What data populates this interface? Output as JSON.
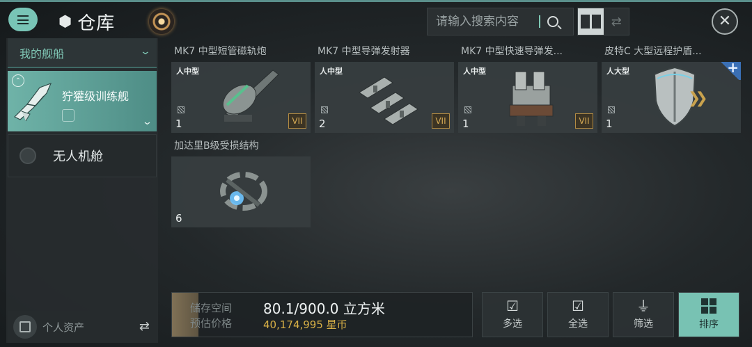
{
  "header": {
    "title": "仓库",
    "search_placeholder": "请输入搜索内容",
    "close_glyph": "✕"
  },
  "sidebar": {
    "dropdown_label": "我的舰船",
    "selected_ship": "狞獾级训练舰",
    "drone_bay": "无人机舱",
    "personal_assets": "个人资产"
  },
  "items": [
    {
      "name": "MK7 中型短管磁轨炮",
      "size": "人中型",
      "qty": "1",
      "tier": "VII",
      "icon": "railgun-icon"
    },
    {
      "name": "MK7 中型导弹发射器",
      "size": "人中型",
      "qty": "2",
      "tier": "VII",
      "icon": "missile-launcher-icon"
    },
    {
      "name": "MK7 中型快速导弹发...",
      "size": "人中型",
      "qty": "1",
      "tier": "VII",
      "icon": "rapid-missile-icon"
    },
    {
      "name": "皮特C 大型远程护盾...",
      "size": "人大型",
      "qty": "1",
      "tier": "",
      "icon": "shield-icon"
    },
    {
      "name": "加达里B级受损结构",
      "size": "",
      "qty": "6",
      "tier": "",
      "icon": "structure-icon"
    }
  ],
  "footer": {
    "storage_label": "储存空间",
    "price_label": "预估价格",
    "storage_value": "80.1/900.0 立方米",
    "price_value": "40,174,995 星币",
    "btn_multi": "多选",
    "btn_all": "全选",
    "btn_filter": "筛选",
    "btn_sort": "排序"
  },
  "colors": {
    "accent": "#78c4b6",
    "gold": "#d8b046",
    "tier_gold": "#b38b43"
  }
}
